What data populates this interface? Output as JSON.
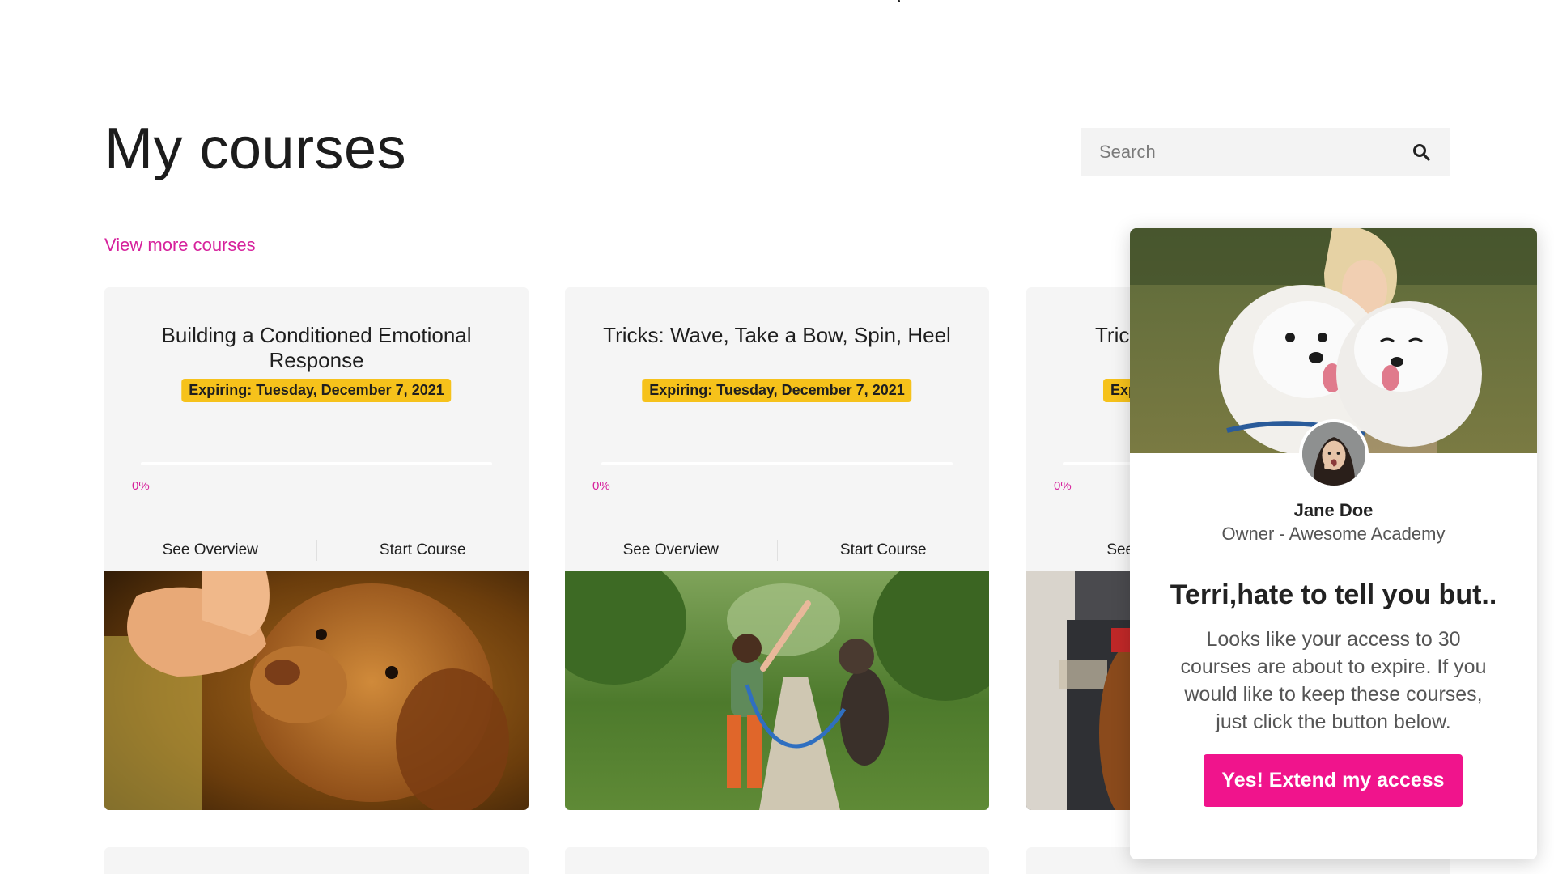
{
  "page": {
    "title": "My courses",
    "view_more_label": "View more courses"
  },
  "search": {
    "placeholder": "Search",
    "value": "",
    "icon": "search-icon"
  },
  "courses": [
    {
      "title": "Building a Conditioned Emotional Response",
      "expiring": "Expiring: Tuesday, December 7, 2021",
      "progress_percent": 0,
      "progress_label": "0%",
      "overview_label": "See Overview",
      "start_label": "Start Course",
      "image": "dog-being-petted-photo"
    },
    {
      "title": "Tricks: Wave, Take a Bow, Spin, Heel",
      "expiring": "Expiring: Tuesday, December 7, 2021",
      "progress_percent": 0,
      "progress_label": "0%",
      "overview_label": "See Overview",
      "start_label": "Start Course",
      "image": "girl-training-dog-photo"
    },
    {
      "title": "Tric",
      "expiring": "Exp",
      "progress_percent": 0,
      "progress_label": "0%",
      "overview_label": "See Ov",
      "image": "dog-on-sofa-photo"
    }
  ],
  "popup": {
    "hero_image": "woman-with-samoyeds-photo",
    "avatar_image": "owner-avatar-photo",
    "name": "Jane Doe",
    "role": "Owner - Awesome Academy",
    "headline": "Terri,hate to tell you but..",
    "body": "Looks like your access to 30 courses are about to expire. If you would like to keep these courses, just click the button below.",
    "cta_label": "Yes! Extend my access"
  },
  "colors": {
    "accent": "#d6219c",
    "cta": "#f0148c",
    "badge": "#f6c21b",
    "card_bg": "#f5f5f5"
  }
}
